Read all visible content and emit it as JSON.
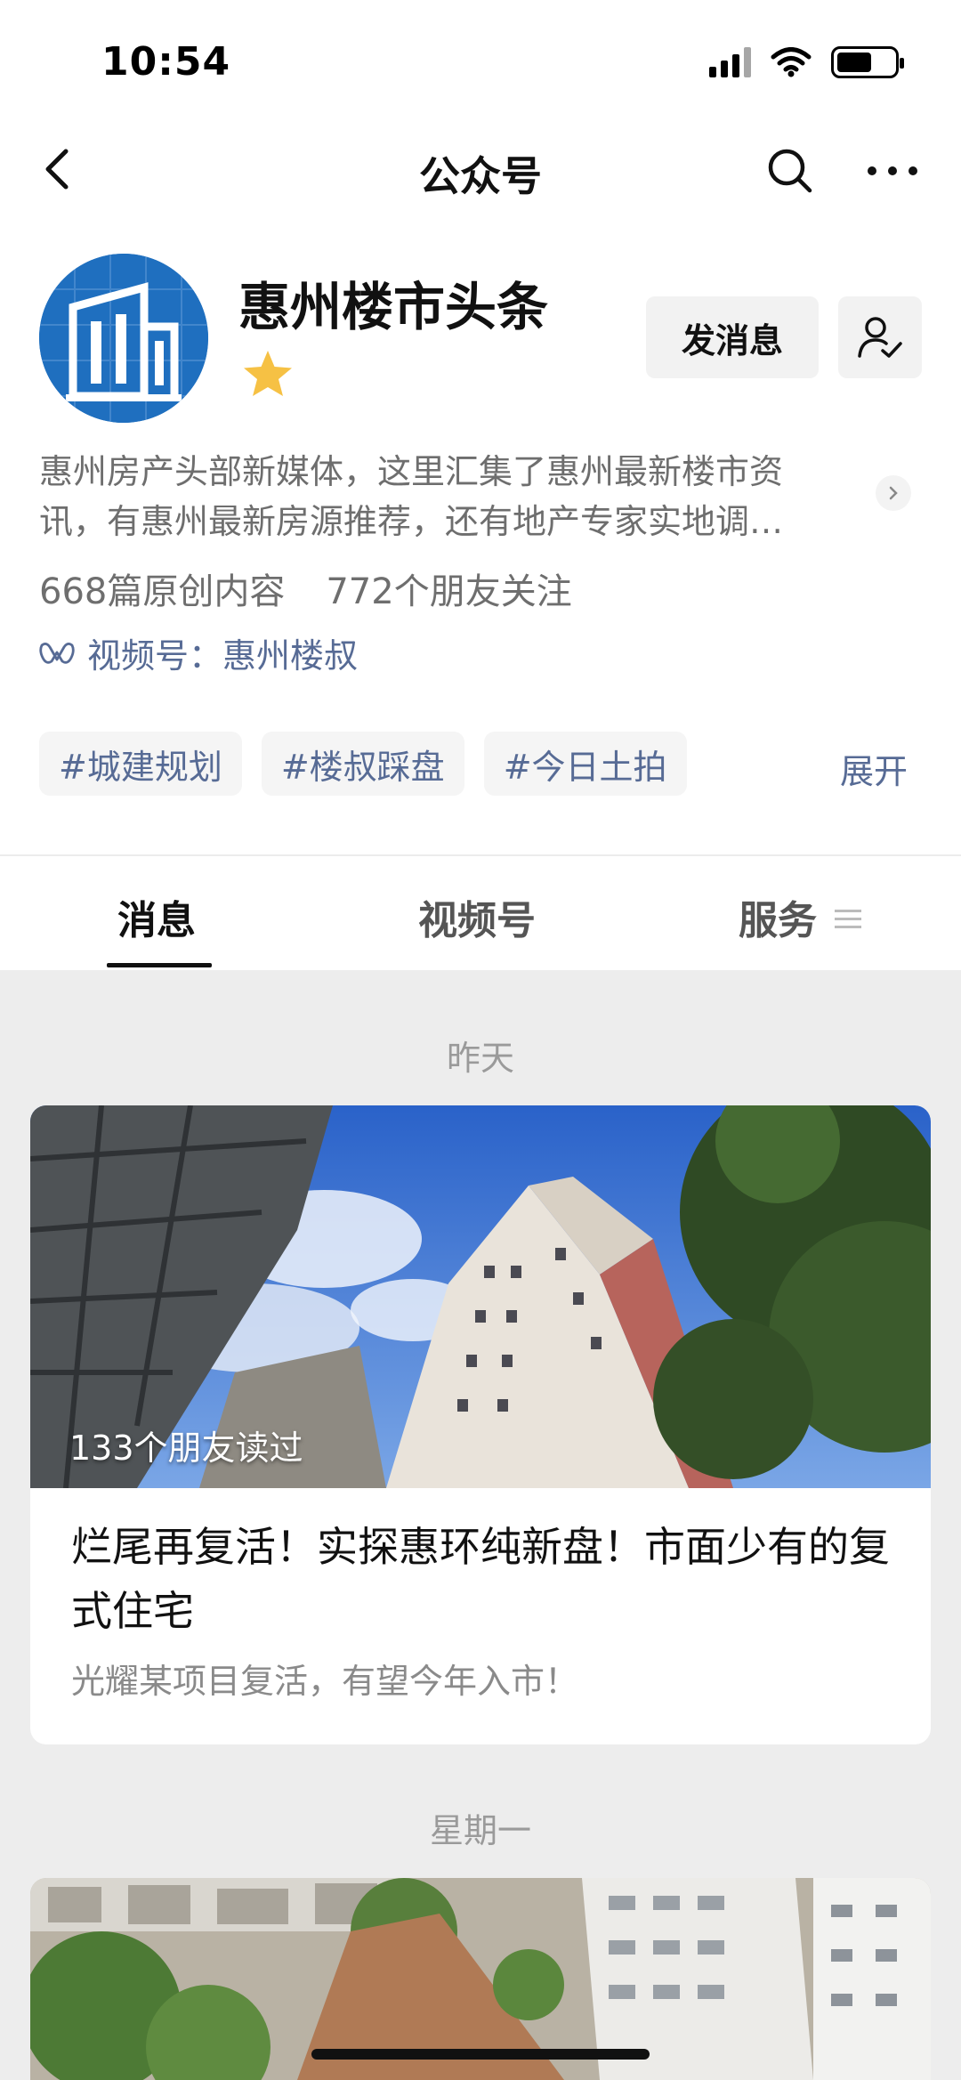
{
  "status_bar": {
    "time": "10:54"
  },
  "nav": {
    "title": "公众号"
  },
  "account": {
    "name": "惠州楼市头条",
    "message_button": "发消息",
    "description_lines": [
      "惠州房产头部新媒体，这里汇集了惠州最新楼市资",
      "讯，有惠州最新房源推荐，还有地产专家实地调…"
    ],
    "original_count": "668篇原创内容",
    "friends_following": "772个朋友关注",
    "channel_label": "视频号：惠州楼叔",
    "tags": [
      "#城建规划",
      "#楼叔踩盘",
      "#今日土拍"
    ],
    "expand_label": "展开"
  },
  "tabs": [
    {
      "label": "消息",
      "active": true
    },
    {
      "label": "视频号",
      "active": false
    },
    {
      "label": "服务",
      "active": false
    }
  ],
  "feed": [
    {
      "date": "昨天",
      "read_count": "133个朋友读过",
      "title": "烂尾再复活！实探惠环纯新盘！市面少有的复式住宅",
      "subtitle": "光耀某项目复活，有望今年入市！"
    },
    {
      "date": "星期一"
    }
  ],
  "colors": {
    "link": "#576b95",
    "background": "#ededed",
    "star": "#f6c144",
    "avatar": "#1f6fbf"
  }
}
